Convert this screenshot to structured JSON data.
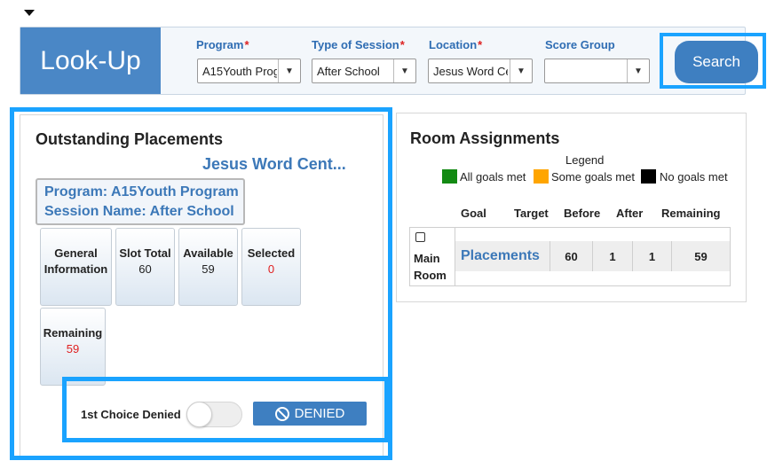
{
  "lookup": {
    "title": "Look-Up",
    "fields": [
      {
        "label": "Program",
        "required": "*",
        "value": "A15Youth Program"
      },
      {
        "label": "Type of Session",
        "required": "*",
        "value": "After School"
      },
      {
        "label": "Location",
        "required": "*",
        "value": "Jesus Word Center"
      },
      {
        "label": "Score Group",
        "required": "",
        "value": ""
      }
    ],
    "search_label": "Search"
  },
  "outstanding": {
    "title": "Outstanding Placements",
    "location_name": "Jesus Word Cent...",
    "program_line": "Program: A15Youth Program",
    "session_line": "Session Name: After School",
    "tiles": [
      {
        "label": "General Information",
        "value": ""
      },
      {
        "label": "Slot Total",
        "value": "60"
      },
      {
        "label": "Available",
        "value": "59"
      },
      {
        "label": "Selected",
        "value": "0"
      },
      {
        "label": "Remaining",
        "value": "59"
      }
    ],
    "first_choice_label": "1st Choice Denied",
    "first_choice_on": false,
    "denied_label": "DENIED"
  },
  "rooms": {
    "title": "Room Assignments",
    "legend_title": "Legend",
    "legend": [
      {
        "label": "All goals met",
        "color": "#138a13"
      },
      {
        "label": "Some goals met",
        "color": "#ffa500"
      },
      {
        "label": "No goals met",
        "color": "#000000"
      }
    ],
    "columns": [
      "Goal",
      "Target",
      "Before",
      "After",
      "Remaining"
    ],
    "rows": [
      {
        "room": "Main Room",
        "goal": "Placements",
        "target": "60",
        "before": "1",
        "after": "1",
        "remaining": "59"
      }
    ]
  },
  "colors": {
    "accent": "#3e7fc1",
    "highlight": "#1aa3ff",
    "link": "#3c78b8",
    "alert": "#e02020"
  }
}
